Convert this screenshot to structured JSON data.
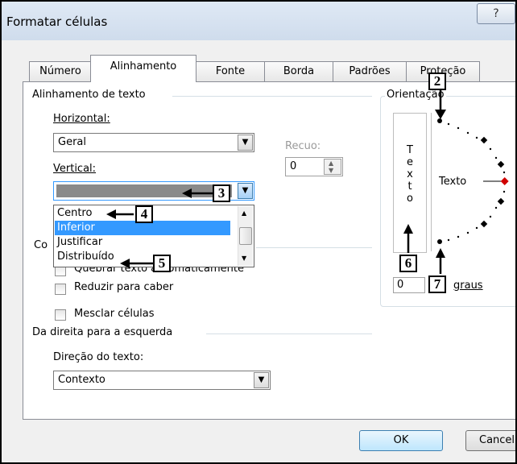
{
  "window": {
    "title": "Formatar células",
    "help_glyph": "?"
  },
  "tabs": [
    {
      "label": "Número"
    },
    {
      "label": "Alinhamento"
    },
    {
      "label": "Fonte"
    },
    {
      "label": "Borda"
    },
    {
      "label": "Padrões"
    },
    {
      "label": "Proteção"
    }
  ],
  "text_alignment": {
    "group_label": "Alinhamento de texto",
    "horizontal_label": "Horizontal:",
    "horizontal_value": "Geral",
    "vertical_label": "Vertical:",
    "vertical_options": [
      "Centro",
      "Inferior",
      "Justificar",
      "Distribuído"
    ],
    "vertical_selected": "Inferior",
    "indent_label": "Recuo:",
    "indent_value": "0"
  },
  "text_control": {
    "group_label_fragment": "Co",
    "wrap_label": "Quebrar texto automaticamente",
    "shrink_label": "Reduzir para caber",
    "merge_label": "Mesclar células"
  },
  "rtl": {
    "group_label": "Da direita para a esquerda",
    "direction_label": "Direção do texto:",
    "direction_value": "Contexto"
  },
  "orientation": {
    "group_label": "Orientação",
    "vertical_text": [
      "T",
      "e",
      "x",
      "t",
      "o"
    ],
    "dial_text": "Texto",
    "degrees_value": "0",
    "degrees_label": "graus"
  },
  "buttons": {
    "ok": "OK",
    "cancel": "Cancel"
  },
  "callouts": [
    "2",
    "3",
    "4",
    "5",
    "6",
    "7"
  ]
}
